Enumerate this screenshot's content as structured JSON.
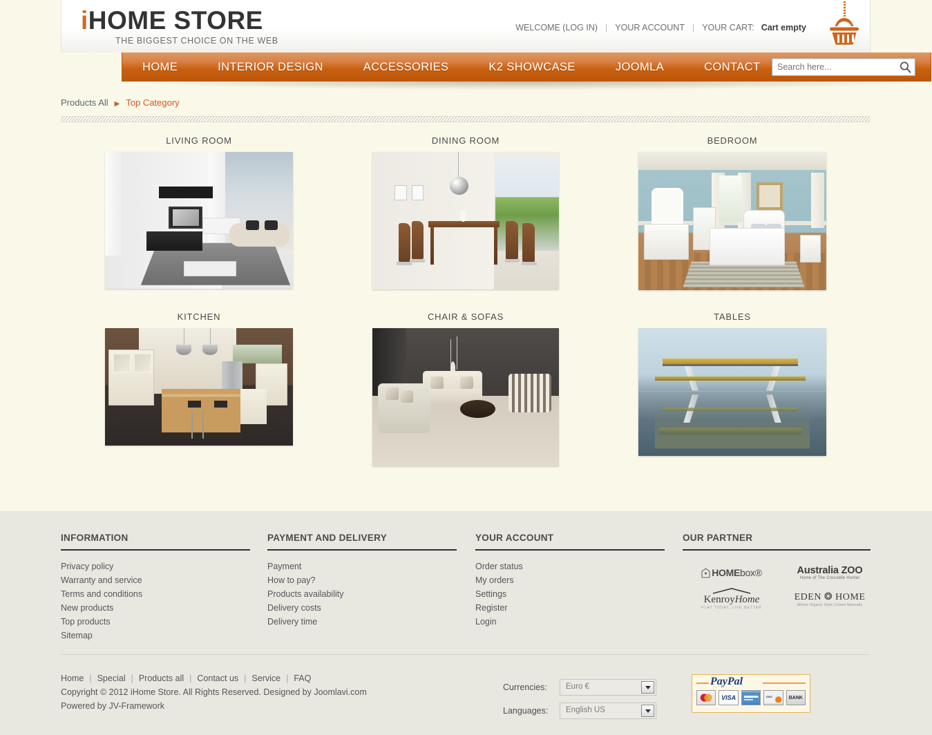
{
  "site": {
    "logo_main_i": "i",
    "logo_main_rest": "HOME STORE",
    "logo_tagline": "THE BIGGEST CHOICE ON THE WEB"
  },
  "header": {
    "welcome": "WELCOME (LOG IN)",
    "account": "YOUR ACCOUNT",
    "cart_label": "YOUR CART:",
    "cart_status": "Cart empty",
    "separator": "|",
    "basket_icon": "shopping-basket-icon"
  },
  "nav": {
    "items": [
      {
        "label": "HOME"
      },
      {
        "label": "INTERIOR DESIGN"
      },
      {
        "label": "ACCESSORIES"
      },
      {
        "label": "K2 SHOWCASE"
      },
      {
        "label": "JOOMLA"
      },
      {
        "label": "CONTACT"
      }
    ],
    "search": {
      "placeholder": "Search here...",
      "value": "",
      "icon": "search-icon"
    },
    "colors": {
      "top": "#dd9a63",
      "bottom": "#bd560b"
    }
  },
  "breadcrumb": {
    "root": "Products All",
    "arrow": "▶",
    "current": "Top Category"
  },
  "categories": [
    {
      "title": "LIVING ROOM",
      "image_alt": "modern white living room with black tv unit and grey rug"
    },
    {
      "title": "DINING ROOM",
      "image_alt": "dining room with wooden table, brown chairs and chrome pendant lamp"
    },
    {
      "title": "BEDROOM",
      "image_alt": "bedroom with blue walls and white furniture set"
    },
    {
      "title": "KITCHEN",
      "image_alt": "kitchen with cream cabinets and wooden island"
    },
    {
      "title": "CHAIR & SOFAS",
      "image_alt": "showroom with cream sofas, striped armchair and round dark coffee table"
    },
    {
      "title": "TABLES",
      "image_alt": "3d render of minimalist table on reflective surface"
    }
  ],
  "footer": {
    "columns": [
      {
        "title": "INFORMATION",
        "links": [
          "Privacy policy",
          "Warranty and service",
          "Terms and conditions",
          "New products",
          "Top products",
          "Sitemap"
        ]
      },
      {
        "title": "PAYMENT AND DELIVERY",
        "links": [
          "Payment",
          "How to pay?",
          "Products availability",
          "Delivery costs",
          "Delivery time"
        ]
      },
      {
        "title": "YOUR ACCOUNT",
        "links": [
          "Order status",
          "My orders",
          "Settings",
          "Register",
          "Login"
        ]
      }
    ],
    "partner_title": "OUR PARTNER",
    "partners": [
      {
        "name": "HOME",
        "suffix": "box®"
      },
      {
        "name": "Australia ZOO",
        "tagline": "Home of The Crocodile Hunter"
      },
      {
        "name_a": "Kenroy",
        "name_b": "Home",
        "tagline": "PLAY TODAY, LIVE BETTER"
      },
      {
        "name": "EDEN ❂ HOME",
        "tagline": "Where Organic Style Comes Naturally"
      }
    ]
  },
  "bottom": {
    "links": [
      "Home",
      "Special",
      "Products all",
      "Contact us",
      "Service",
      "FAQ"
    ],
    "separator": "|",
    "copyright": "Copyright © 2012 iHome Store. All Rights Reserved. Designed by Joomlavi.com",
    "powered": "Powered by JV-Framework",
    "currencies_label": "Currencies:",
    "currency_value": "Euro €",
    "languages_label": "Languages:",
    "language_value": "English US",
    "paypal": {
      "brand": "PayPal",
      "cards": [
        "MasterCard",
        "VISA",
        "AMEX",
        "DISCOVER",
        "BANK"
      ]
    }
  },
  "colors": {
    "accent": "#cf5a21",
    "nav_orange": "#c8600f",
    "page_bg": "#faf8e8",
    "footer_bg": "#e8e7e0"
  }
}
